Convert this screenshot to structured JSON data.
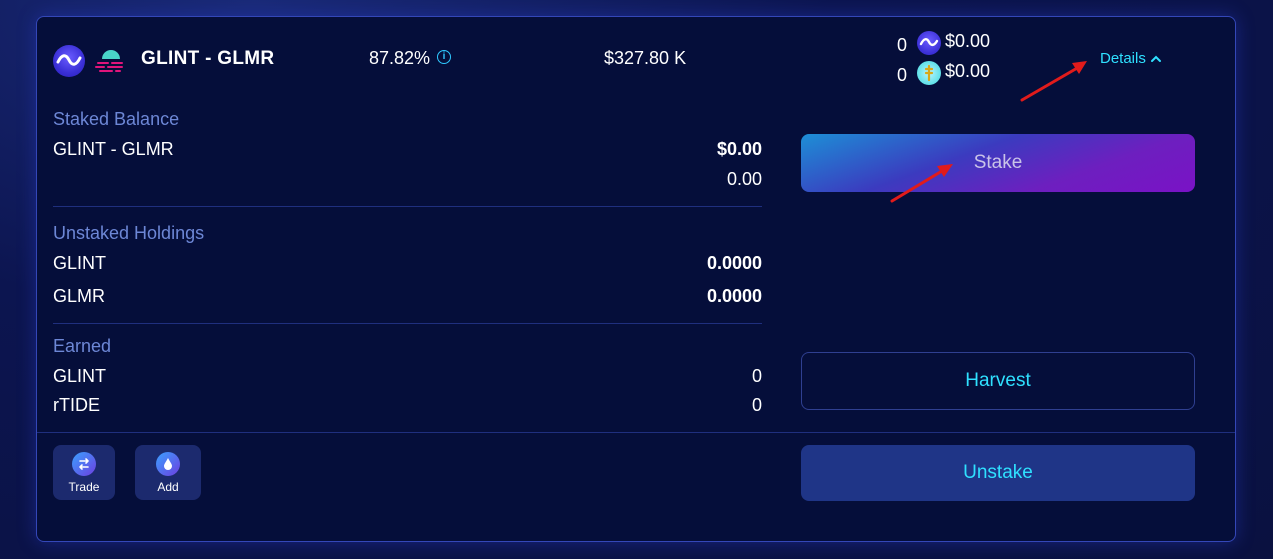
{
  "header": {
    "pair_name": "GLINT - GLMR",
    "apr": "87.82%",
    "tvl": "$327.80 K",
    "rewards": [
      {
        "amount": "0",
        "token_icon": "glint-token-icon",
        "usd": "$0.00"
      },
      {
        "amount": "0",
        "token_icon": "rtide-token-icon",
        "usd": "$0.00"
      }
    ],
    "details_label": "Details"
  },
  "staked": {
    "title": "Staked Balance",
    "label": "GLINT - GLMR",
    "usd": "$0.00",
    "amount": "0.00"
  },
  "unstaked": {
    "title": "Unstaked Holdings",
    "rows": [
      {
        "label": "GLINT",
        "value": "0.0000"
      },
      {
        "label": "GLMR",
        "value": "0.0000"
      }
    ]
  },
  "earned": {
    "title": "Earned",
    "rows": [
      {
        "label": "GLINT",
        "value": "0"
      },
      {
        "label": "rTIDE",
        "value": "0"
      }
    ]
  },
  "actions": {
    "stake": "Stake",
    "harvest": "Harvest",
    "unstake": "Unstake",
    "trade": "Trade",
    "add": "Add"
  },
  "colors": {
    "card_bg": "#050e3a",
    "accent_cyan": "#2fe0ff",
    "section_title": "#6d87d6",
    "arrow": "#e11b1b"
  }
}
